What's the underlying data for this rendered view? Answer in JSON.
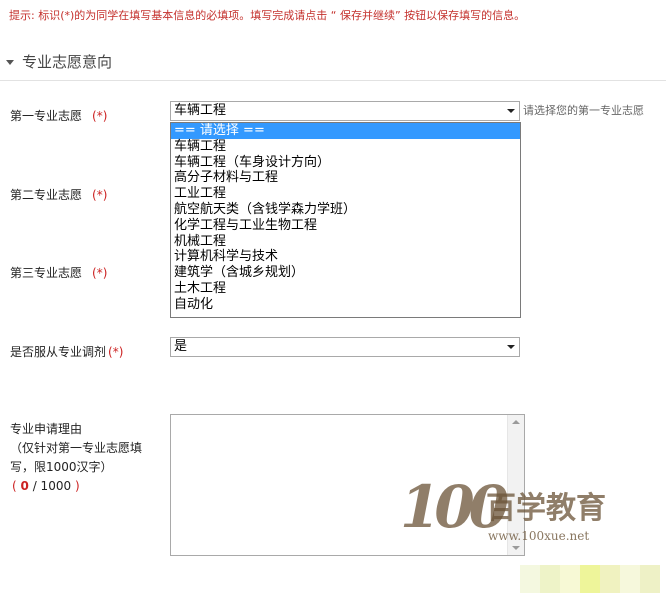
{
  "notice": "提示: 标识(*)的为同学在填写基本信息的必填项。填写完成请点击 “ 保存并继续” 按钮以保存填写的信息。",
  "section": {
    "title": "专业志愿意向"
  },
  "fields": {
    "first_choice": {
      "label": "第一专业志愿",
      "required_mark": "(*)",
      "value": "车辆工程",
      "hint": "请选择您的第一专业志愿"
    },
    "second_choice": {
      "label": "第二专业志愿",
      "required_mark": "(*)"
    },
    "third_choice": {
      "label": "第三专业志愿",
      "required_mark": "(*)"
    },
    "adjust": {
      "label": "是否服从专业调剂",
      "required_mark": "(*)",
      "value": "是"
    },
    "reason": {
      "label_line1": "专业申请理由",
      "label_line2": "（仅针对第一专业志愿填",
      "label_line3": "写，限1000汉字）",
      "counter_open": "(",
      "counter_value": "0",
      "counter_max": "/ 1000",
      "counter_close": ")"
    }
  },
  "dropdown_options": [
    "== 请选择 ==",
    "车辆工程",
    "车辆工程（车身设计方向）",
    "高分子材料与工程",
    "工业工程",
    "航空航天类（含钱学森力学班）",
    "化学工程与工业生物工程",
    "机械工程",
    "计算机科学与技术",
    "建筑学（含城乡规划）",
    "土木工程",
    "自动化"
  ],
  "watermark": {
    "number": "100",
    "name": "百学教育",
    "url": "www.100xue.net"
  },
  "colors": {
    "required": "#cc2222",
    "highlight": "#3399ff",
    "logo": "#6b5438"
  }
}
